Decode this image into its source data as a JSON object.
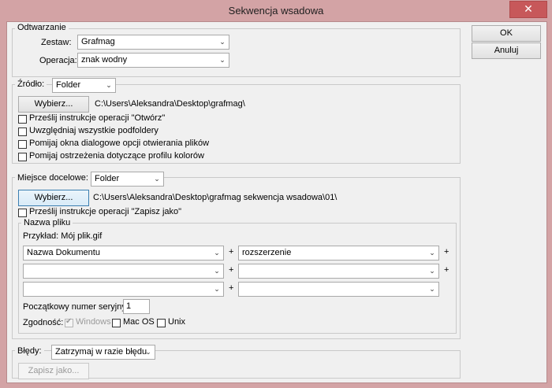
{
  "window": {
    "title": "Sekwencja wsadowa",
    "close_glyph": "✕"
  },
  "buttons": {
    "ok": "OK",
    "cancel": "Anuluj"
  },
  "play": {
    "legend": "Odtwarzanie",
    "set_label": "Zestaw:",
    "set_value": "Grafmag",
    "action_label": "Operacja:",
    "action_value": "znak wodny"
  },
  "source": {
    "label": "Źródło:",
    "value": "Folder",
    "choose_button": "Wybierz...",
    "path": "C:\\Users\\Aleksandra\\Desktop\\grafmag\\",
    "options": [
      "Prześlij instrukcje operacji \"Otwórz\"",
      "Uwzględniaj wszystkie podfoldery",
      "Pomijaj okna dialogowe opcji otwierania plików",
      "Pomijaj ostrzeżenia dotyczące profilu kolorów"
    ]
  },
  "destination": {
    "label": "Miejsce docelowe:",
    "value": "Folder",
    "choose_button": "Wybierz...",
    "path": "C:\\Users\\Aleksandra\\Desktop\\grafmag sekwencja wsadowa\\01\\",
    "override_save": "Prześlij instrukcje operacji \"Zapisz jako\"",
    "file_naming": {
      "legend": "Nazwa pliku",
      "example": "Przykład: Mój plik.gif",
      "rows": [
        {
          "left": "Nazwa Dokumentu",
          "right": "rozszerzenie"
        },
        {
          "left": "",
          "right": ""
        },
        {
          "left": "",
          "right": ""
        }
      ],
      "plus": "+",
      "serial_label": "Początkowy numer seryjny:",
      "serial_value": "1",
      "compat_label": "Zgodność:",
      "compat": {
        "windows": "Windows",
        "macos": "Mac OS",
        "unix": "Unix"
      }
    }
  },
  "errors": {
    "label": "Błędy:",
    "value": "Zatrzymaj w razie błędu",
    "save_as_button": "Zapisz jako..."
  },
  "icons": {
    "chevron": "⌄",
    "check": "✔"
  }
}
